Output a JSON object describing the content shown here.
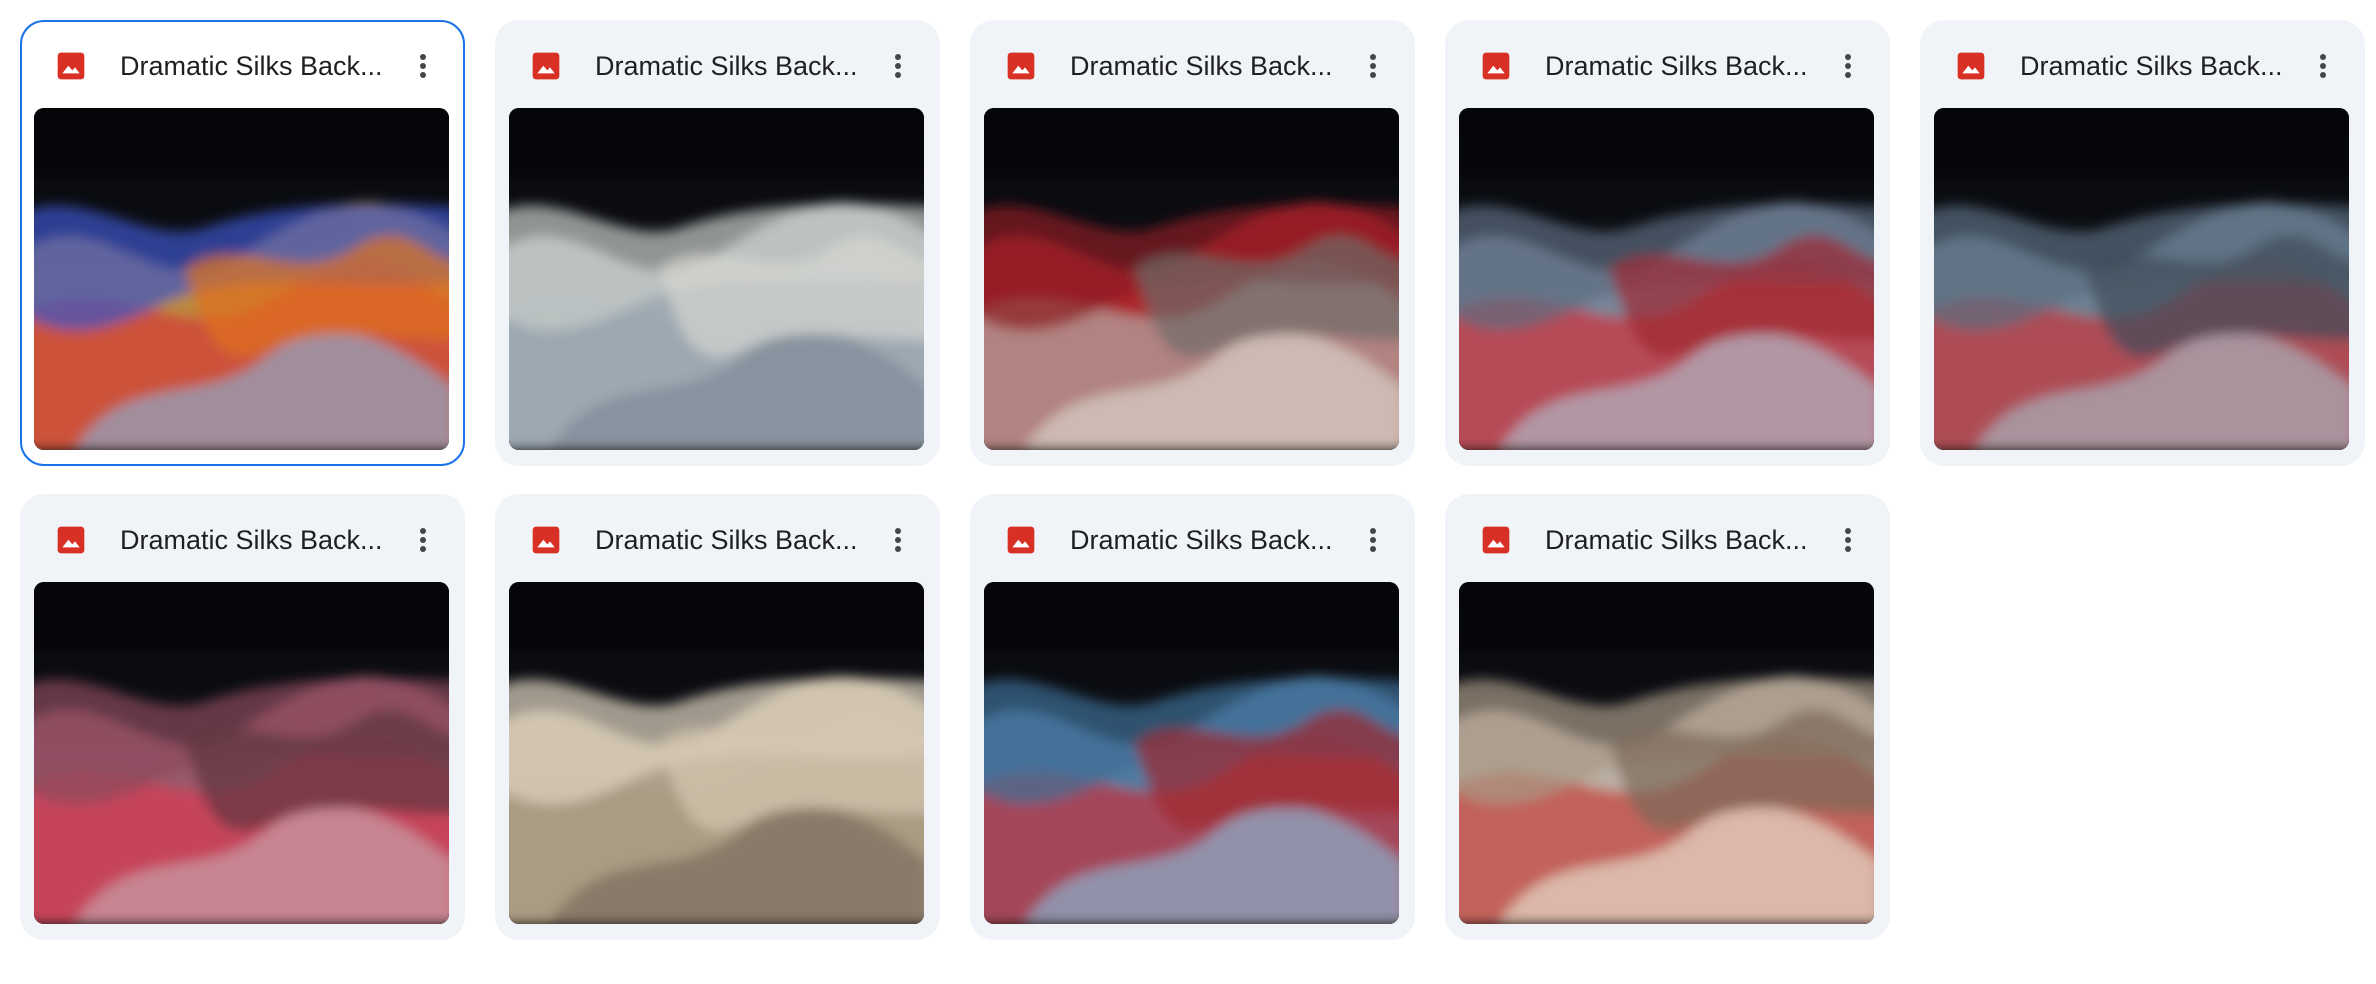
{
  "files": [
    {
      "name": "Dramatic Silks Back...",
      "selected": true,
      "palette": [
        "#d8a045",
        "#d33a3a",
        "#3a56c8",
        "#8fa8c8",
        "#e0701e"
      ]
    },
    {
      "name": "Dramatic Silks Back...",
      "selected": false,
      "palette": [
        "#b8c4cc",
        "#9aa7b2",
        "#c8ccc8",
        "#7d8a96",
        "#d6d6d0"
      ]
    },
    {
      "name": "Dramatic Silks Back...",
      "selected": false,
      "palette": [
        "#c8282f",
        "#b3aba5",
        "#8c1d22",
        "#d9d0c8",
        "#6e6b68"
      ]
    },
    {
      "name": "Dramatic Silks Back...",
      "selected": false,
      "palette": [
        "#8a9bb0",
        "#d2303a",
        "#5d6c80",
        "#b0b8c4",
        "#a02630"
      ]
    },
    {
      "name": "Dramatic Silks Back...",
      "selected": false,
      "palette": [
        "#7f95a8",
        "#c9363a",
        "#5a6e80",
        "#a6b2bc",
        "#3e4c58"
      ]
    },
    {
      "name": "Dramatic Silks Back...",
      "selected": false,
      "palette": [
        "#b0667a",
        "#d83a52",
        "#8a4a5c",
        "#c8a0aa",
        "#5e3440"
      ]
    },
    {
      "name": "Dramatic Silks Back...",
      "selected": false,
      "palette": [
        "#c8b8a0",
        "#a89880",
        "#e0d4c0",
        "#7a6e5e",
        "#d6c8b0"
      ]
    },
    {
      "name": "Dramatic Silks Back...",
      "selected": false,
      "palette": [
        "#5a8fb8",
        "#c8303a",
        "#3d6e96",
        "#8ab0cc",
        "#a0262e"
      ]
    },
    {
      "name": "Dramatic Silks Back...",
      "selected": false,
      "palette": [
        "#d8ccbc",
        "#c4403a",
        "#a89886",
        "#e6dccc",
        "#7a6a5a"
      ]
    }
  ],
  "colors": {
    "card_bg": "#f0f4f9",
    "selected_border": "#1a73e8",
    "image_icon": "#d93025",
    "text": "#1f1f1f"
  },
  "icons": {
    "file_type": "image-file-icon",
    "menu": "more-vert-icon"
  }
}
